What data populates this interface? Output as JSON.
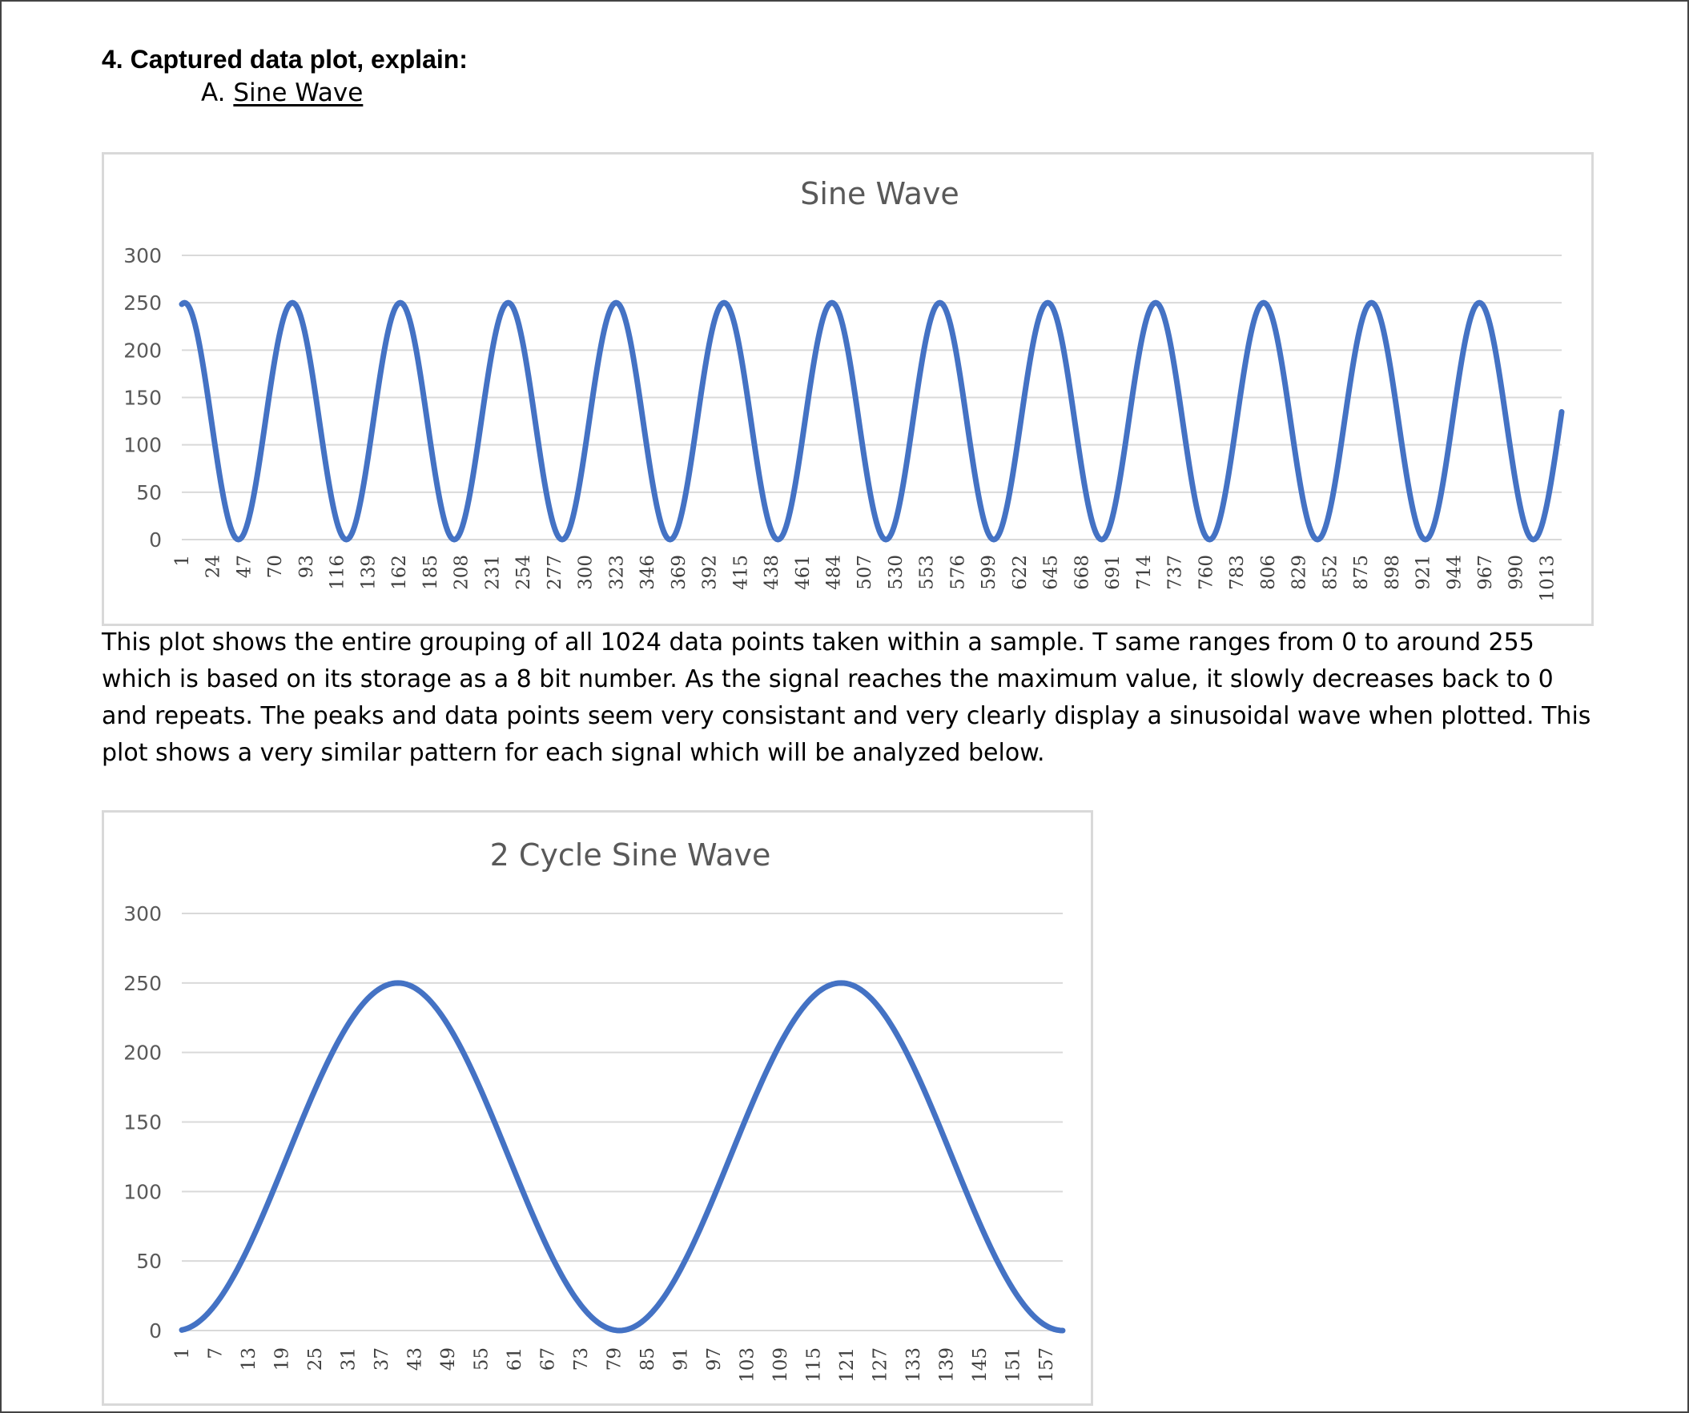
{
  "heading": "4. Captured data plot, explain:",
  "subheading": {
    "prefix": "A.",
    "label": "Sine Wave"
  },
  "paragraph": "This plot shows the entire grouping of all 1024 data points taken within a sample. T same ranges from 0 to around 255 which is based on its storage as a 8 bit number. As the signal reaches the maximum value, it slowly decreases back to 0 and repeats. The peaks and data points seem very consistant and very clearly display a sinusoidal wave when plotted. This plot shows a very similar pattern for each signal which will be analyzed below.",
  "colors": {
    "series": "#4472c4",
    "gridline": "#d9d9d9",
    "text": "#595959"
  },
  "chart_data": [
    {
      "type": "line",
      "title": "Sine Wave",
      "xlabel": "",
      "ylabel": "",
      "ylim": [
        0,
        300
      ],
      "yticks": [
        0,
        50,
        100,
        150,
        200,
        250,
        300
      ],
      "x_range": [
        1,
        1024
      ],
      "xticks": [
        "1",
        "24",
        "47",
        "70",
        "93",
        "116",
        "139",
        "162",
        "185",
        "208",
        "231",
        "254",
        "277",
        "300",
        "323",
        "346",
        "369",
        "392",
        "415",
        "438",
        "461",
        "484",
        "507",
        "530",
        "553",
        "576",
        "599",
        "622",
        "645",
        "668",
        "691",
        "714",
        "737",
        "760",
        "783",
        "806",
        "829",
        "852",
        "875",
        "898",
        "921",
        "944",
        "967",
        "990",
        "1013"
      ],
      "grid": "horizontal",
      "legend": "none",
      "series": [
        {
          "waveform": "sine",
          "min": 0,
          "max": 250,
          "samples": 1024,
          "period_samples": 80,
          "peak_at_sample": 3
        }
      ]
    },
    {
      "type": "line",
      "title": "2 Cycle Sine Wave",
      "xlabel": "",
      "ylabel": "",
      "ylim": [
        0,
        300
      ],
      "yticks": [
        0,
        50,
        100,
        150,
        200,
        250,
        300
      ],
      "x_range": [
        1,
        160
      ],
      "xticks": [
        "1",
        "7",
        "13",
        "19",
        "25",
        "31",
        "37",
        "43",
        "49",
        "55",
        "61",
        "67",
        "73",
        "79",
        "85",
        "91",
        "97",
        "103",
        "109",
        "115",
        "121",
        "127",
        "133",
        "139",
        "145",
        "151",
        "157"
      ],
      "grid": "horizontal",
      "legend": "none",
      "series": [
        {
          "waveform": "sine",
          "min": 0,
          "max": 250,
          "samples": 160,
          "period_samples": 80,
          "peak_at_sample": 40
        }
      ]
    }
  ]
}
